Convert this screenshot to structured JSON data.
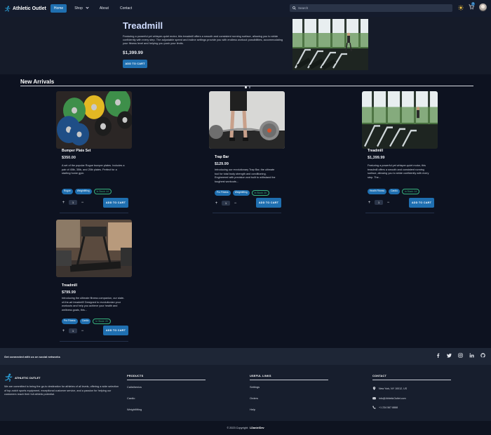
{
  "nav": {
    "logo": "Athletic Outlet",
    "links": [
      "Home",
      "Shop",
      "About",
      "Contact"
    ],
    "search_placeholder": "Search",
    "cart_count": "1"
  },
  "hero": {
    "title": "Treadmill",
    "description": "Featuring a powerful yet whisper-quiet motor, this treadmill offers a smooth and consistent running surface, allowing you to stride confidently with every step. The adjustable speed and incline settings provide you with endless workout possibilities, accommodating your fitness level and helping you push your limits.",
    "price": "$1,399.99",
    "button": "ADD TO CART",
    "slides": 2,
    "active_slide": 1
  },
  "new_arrivals": {
    "title": "New Arrivals",
    "products": [
      {
        "name": "Bumper Plate Set",
        "price": "$350.00",
        "description": "A set of the popular Rogue bumper plates. Includes a pair of 45lb, 35lb, and 25lb plates. Perfect for a starting home gym.",
        "tags": [
          "Rogue",
          "Weightlifting"
        ],
        "stock": "In Stock: 44",
        "qty": "1",
        "button": "ADD TO CART",
        "image": "bumper-plates"
      },
      {
        "name": "Trap Bar",
        "price": "$129.99",
        "description": "Introducing our revolutionary Trap Bar, the ultimate tool for total body strength and conditioning. Engineered with precision and built to withstand the toughest workouts...",
        "tags": [
          "Pro Fitness",
          "Weightlifting"
        ],
        "stock": "In Stock: 20",
        "qty": "1",
        "button": "ADD TO CART",
        "image": "trap-bar"
      },
      {
        "name": "Treadmill",
        "price": "$1,399.99",
        "description": "Featuring a powerful yet whisper-quiet motor, this treadmill offers a smooth and consistent running surface, allowing you to stride confidently with every step. The...",
        "tags": [
          "Health Fitness",
          "Cardio"
        ],
        "stock": "In Stock: 14",
        "qty": "1",
        "button": "ADD TO CART",
        "image": "treadmill-gym"
      },
      {
        "name": "Treadmill",
        "price": "$799.99",
        "description": "Introducing the ultimate fitness companion, our state-of-the-art treadmill! Designed to revolutionize your workouts and help you achieve your health and wellness goals, this...",
        "tags": [
          "Pro Fitness",
          "Cardio"
        ],
        "stock": "In Stock: 20",
        "qty": "1",
        "button": "ADD TO CART",
        "image": "treadmill-home"
      }
    ]
  },
  "social": {
    "text": "Get connected with us on social networks",
    "icons": [
      "facebook-icon",
      "twitter-icon",
      "instagram-icon",
      "linkedin-icon",
      "github-icon"
    ]
  },
  "footer": {
    "brand": "ATHLETIC OUTLET",
    "about": "We are committed to being the go-to destination for athletes of all levels, offering a wide selection of top-notch sports equipment, exceptional customer service, and a passion for helping our customers reach their full athletic potential.",
    "products_title": "PRODUCTS",
    "products": [
      "Calisthenics",
      "Cardio",
      "Weightlifting"
    ],
    "useful_title": "USEFUL LINKS",
    "useful": [
      "Settings",
      "Orders",
      "Help"
    ],
    "contact_title": "CONTACT",
    "contact": [
      "New York, NY 10012, US",
      "info@AthleticOutlet.com",
      "+1 234 567 8888"
    ],
    "copyright_prefix": "© 2023 Copyright:",
    "copyright_name": "LDanielDev"
  },
  "colors": {
    "accent": "#1f6fb0",
    "background": "#0d1220",
    "stock": "#37b37e"
  }
}
